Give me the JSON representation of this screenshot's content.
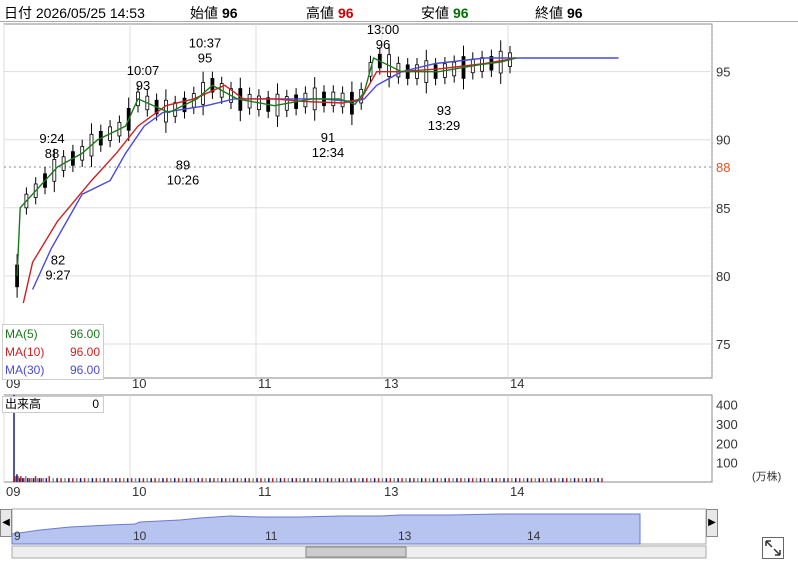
{
  "header": {
    "date_label": "日付",
    "datetime": "2026/05/25 14:53",
    "open_label": "始値",
    "open": "96",
    "high_label": "高値",
    "high": "96",
    "low_label": "安値",
    "low": "96",
    "close_label": "終値",
    "close": "96"
  },
  "colors": {
    "up": "#d01010",
    "down": "#000000",
    "ma5": "#1a7a1a",
    "ma10": "#d02020",
    "ma30": "#4a4ad8",
    "ref_line": "#e05020",
    "nav_fill": "#b8c4f0",
    "high": "#d00000",
    "low": "#007000"
  },
  "legend": {
    "ma5": {
      "label": "MA(5)",
      "value": "96.00"
    },
    "ma10": {
      "label": "MA(10)",
      "value": "96.00"
    },
    "ma30": {
      "label": "MA(30)",
      "value": "96.00"
    }
  },
  "volume_panel": {
    "label": "出来高",
    "value": "0",
    "unit": "(万株)",
    "ticks": [
      "400",
      "300",
      "200",
      "100"
    ]
  },
  "chart_data": {
    "type": "candlestick",
    "title": "",
    "xlabel": "",
    "ylabel": "",
    "x_tick_labels": [
      "09",
      "10",
      "11",
      "13",
      "14"
    ],
    "y_ticks": [
      95,
      90,
      85,
      80,
      75
    ],
    "ylim": [
      72.5,
      98.5
    ],
    "reference_price": 88,
    "reference_label": "88",
    "grid": true,
    "annotations": [
      {
        "time": "9:24",
        "price": 88,
        "position": "above"
      },
      {
        "time": "9:27",
        "price": 82,
        "position": "below"
      },
      {
        "time": "10:07",
        "price": 93,
        "position": "above"
      },
      {
        "time": "10:26",
        "price": 89,
        "position": "below"
      },
      {
        "time": "10:37",
        "price": 95,
        "position": "above"
      },
      {
        "time": "12:34",
        "price": 91,
        "position": "below"
      },
      {
        "time": "13:00",
        "price": 96,
        "position": "above"
      },
      {
        "time": "13:29",
        "price": 93,
        "position": "below"
      }
    ],
    "ma5_points": [
      [
        80,
        9
      ],
      [
        85,
        10
      ],
      [
        88,
        22
      ],
      [
        89,
        30
      ],
      [
        90,
        35
      ],
      [
        91,
        44
      ],
      [
        93,
        48
      ],
      [
        92,
        58
      ],
      [
        93,
        67
      ],
      [
        94,
        72
      ],
      [
        93,
        80
      ],
      [
        92.5,
        92
      ],
      [
        93,
        104
      ],
      [
        93,
        113
      ],
      [
        92.6,
        118
      ],
      [
        93.5,
        121
      ],
      [
        96,
        124
      ],
      [
        95,
        133
      ],
      [
        95,
        145
      ],
      [
        95.5,
        158
      ],
      [
        95.7,
        165
      ],
      [
        96,
        170
      ]
    ],
    "ma10_points": [
      [
        78,
        11
      ],
      [
        81,
        14
      ],
      [
        84,
        22
      ],
      [
        87,
        33
      ],
      [
        89,
        41
      ],
      [
        91,
        48
      ],
      [
        92.5,
        57
      ],
      [
        93,
        66
      ],
      [
        94,
        76
      ],
      [
        93,
        82
      ],
      [
        93,
        92
      ],
      [
        92.8,
        102
      ],
      [
        92.7,
        114
      ],
      [
        93,
        120
      ],
      [
        95,
        125
      ],
      [
        95,
        132
      ],
      [
        95.2,
        145
      ],
      [
        95.6,
        160
      ],
      [
        96,
        170
      ]
    ],
    "ma30_points": [
      [
        79,
        14
      ],
      [
        82,
        20
      ],
      [
        84,
        25
      ],
      [
        86,
        30
      ],
      [
        87,
        39
      ],
      [
        89,
        44
      ],
      [
        91,
        50
      ],
      [
        92,
        56
      ],
      [
        92.5,
        70
      ],
      [
        93,
        79
      ],
      [
        93,
        94
      ],
      [
        93,
        107
      ],
      [
        92.8,
        118
      ],
      [
        93,
        121
      ],
      [
        94,
        125
      ],
      [
        95,
        133
      ],
      [
        95.6,
        144
      ],
      [
        96,
        160
      ],
      [
        96,
        203
      ]
    ],
    "volume_points": [
      [
        4.5,
        0
      ],
      [
        0.3,
        1
      ],
      [
        0.3,
        2
      ],
      [
        0.4,
        3
      ],
      [
        0.3,
        4
      ],
      [
        0.2,
        5
      ],
      [
        0.2,
        6
      ],
      [
        0.3,
        7
      ],
      [
        0.2,
        8
      ],
      [
        0.2,
        9
      ],
      [
        0.2,
        10
      ],
      [
        0.3,
        12
      ],
      [
        0.2,
        14
      ],
      [
        0.2,
        16
      ],
      [
        0.2,
        18
      ],
      [
        0.2,
        20
      ],
      [
        0.3,
        22
      ],
      [
        0.2,
        24
      ],
      [
        0.2,
        26
      ],
      [
        0.2,
        28
      ],
      [
        0.2,
        30
      ],
      [
        0.2,
        33
      ],
      [
        0.3,
        36
      ],
      [
        0.2,
        40
      ],
      [
        0.2,
        44
      ],
      [
        0.2,
        48
      ],
      [
        0.2,
        52
      ],
      [
        0.2,
        56
      ],
      [
        0.2,
        60
      ],
      [
        0.2,
        64
      ],
      [
        0.2,
        68
      ],
      [
        0.2,
        72
      ],
      [
        0.2,
        76
      ],
      [
        0.2,
        80
      ],
      [
        0.2,
        84
      ],
      [
        0.2,
        88
      ],
      [
        0.2,
        92
      ],
      [
        0.2,
        96
      ],
      [
        0.2,
        100
      ],
      [
        0.2,
        104
      ],
      [
        0.2,
        108
      ],
      [
        0.2,
        112
      ],
      [
        0.2,
        116
      ],
      [
        0.2,
        120
      ],
      [
        0.2,
        124
      ],
      [
        0.2,
        128
      ],
      [
        0.2,
        132
      ],
      [
        0.2,
        136
      ],
      [
        0.2,
        140
      ],
      [
        0.2,
        144
      ],
      [
        0.2,
        148
      ],
      [
        0.2,
        152
      ],
      [
        0.2,
        156
      ],
      [
        0.2,
        160
      ],
      [
        0.2,
        164
      ],
      [
        0.2,
        168
      ],
      [
        0.2,
        172
      ],
      [
        0.2,
        176
      ],
      [
        0.2,
        180
      ],
      [
        0.2,
        184
      ],
      [
        0.2,
        188
      ],
      [
        0.2,
        192
      ],
      [
        0.2,
        196
      ],
      [
        0.2,
        200
      ],
      [
        0.2,
        204
      ],
      [
        0.2,
        208
      ],
      [
        0.2,
        212
      ],
      [
        0.2,
        216
      ],
      [
        0.2,
        220
      ],
      [
        0.2,
        224
      ],
      [
        0.2,
        228
      ],
      [
        0.2,
        232
      ],
      [
        0.2,
        236
      ],
      [
        0.2,
        240
      ],
      [
        0.2,
        244
      ],
      [
        0.2,
        248
      ],
      [
        0.2,
        252
      ],
      [
        0.2,
        256
      ],
      [
        0.2,
        260
      ],
      [
        0.2,
        264
      ],
      [
        0.2,
        268
      ],
      [
        0.2,
        272
      ],
      [
        0.2,
        276
      ],
      [
        0.2,
        280
      ],
      [
        0.2,
        284
      ],
      [
        0.2,
        288
      ],
      [
        0.2,
        292
      ],
      [
        0.2,
        296
      ],
      [
        0.2,
        300
      ],
      [
        0.2,
        304
      ],
      [
        0.2,
        308
      ],
      [
        0.2,
        312
      ],
      [
        0.2,
        316
      ],
      [
        0.2,
        320
      ],
      [
        0.2,
        324
      ],
      [
        0.2,
        328
      ],
      [
        0.2,
        332
      ],
      [
        0.2,
        336
      ],
      [
        0.2,
        340
      ],
      [
        0.2,
        344
      ],
      [
        0.2,
        348
      ],
      [
        0.2,
        352
      ],
      [
        0.2,
        356
      ],
      [
        0.2,
        360
      ],
      [
        0.2,
        364
      ],
      [
        0.2,
        368
      ],
      [
        0.2,
        372
      ],
      [
        0.2,
        376
      ],
      [
        0.2,
        380
      ],
      [
        0.2,
        384
      ],
      [
        0.2,
        388
      ],
      [
        0.2,
        392
      ],
      [
        0.2,
        396
      ],
      [
        0.2,
        400
      ],
      [
        0.2,
        404
      ],
      [
        0.2,
        408
      ],
      [
        0.2,
        412
      ],
      [
        0.2,
        416
      ],
      [
        0.2,
        420
      ],
      [
        0.2,
        424
      ],
      [
        0.2,
        428
      ],
      [
        0.2,
        432
      ],
      [
        0.2,
        436
      ],
      [
        0.2,
        440
      ],
      [
        0.2,
        444
      ],
      [
        0.2,
        448
      ],
      [
        0.2,
        452
      ],
      [
        0.2,
        456
      ],
      [
        0.2,
        460
      ],
      [
        0.2,
        464
      ],
      [
        0.2,
        468
      ],
      [
        0.2,
        472
      ],
      [
        0.2,
        476
      ],
      [
        0.2,
        480
      ],
      [
        0.2,
        484
      ],
      [
        0.2,
        488
      ],
      [
        0.2,
        492
      ],
      [
        0.2,
        496
      ],
      [
        0.2,
        500
      ],
      [
        0.2,
        504
      ],
      [
        0.2,
        508
      ],
      [
        0.2,
        512
      ],
      [
        0.2,
        516
      ],
      [
        0.2,
        520
      ],
      [
        0.2,
        524
      ],
      [
        0.2,
        528
      ],
      [
        0.2,
        532
      ],
      [
        0.2,
        536
      ],
      [
        0.2,
        540
      ],
      [
        0.2,
        544
      ],
      [
        0.2,
        548
      ],
      [
        0.2,
        552
      ],
      [
        0.2,
        556
      ],
      [
        0.2,
        560
      ],
      [
        0.2,
        564
      ],
      [
        0.2,
        568
      ],
      [
        0.2,
        572
      ],
      [
        0.2,
        576
      ],
      [
        0.2,
        580
      ],
      [
        0.2,
        584
      ],
      [
        0.2,
        588
      ],
      [
        0.2,
        592
      ],
      [
        0.2,
        596
      ],
      [
        0.2,
        600
      ]
    ],
    "volume_ylim": [
      0,
      450
    ]
  },
  "navigator": {
    "labels": [
      "9",
      "10",
      "11",
      "13",
      "14"
    ]
  }
}
